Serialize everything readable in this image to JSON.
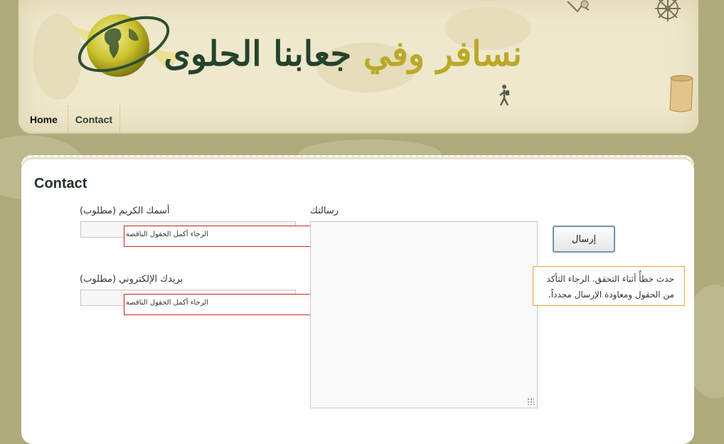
{
  "site": {
    "title_part_dark_1": "جعابنا الحلوى",
    "title_part_gold": "نسافر وفي"
  },
  "nav": {
    "items": [
      {
        "label": "Home"
      },
      {
        "label": "Contact"
      }
    ]
  },
  "page": {
    "heading": "Contact"
  },
  "form": {
    "name_label": "أسمك الكريم (مطلوب)",
    "name_value": "",
    "email_label": "بريدك الإلكتروني (مطلوب)",
    "email_value": "",
    "message_label": "رسالتك",
    "message_value": "",
    "name_error": "الرجاء أكمل الحقول الناقصة",
    "email_error": "الرجاء أكمل الحقول الناقصة",
    "send_label": "إرسال",
    "status_line_1": "حدث خطأٌ أثناء التحقق. الرجاء التأكد",
    "status_line_2": "من الحقول ومعاودة الإرسال مجدداً."
  },
  "colors": {
    "background": "#aeaa7c",
    "header_paper": "#efe8cc",
    "title_dark": "#24422e",
    "title_gold": "#b9a928",
    "error_border": "#c0282c",
    "status_border": "#e3a63a",
    "button_border": "#6e95ad"
  },
  "icons": [
    "globe-logo-icon",
    "ship-wheel-icon",
    "hiker-icon",
    "scroll-icon",
    "parrot-icon"
  ]
}
